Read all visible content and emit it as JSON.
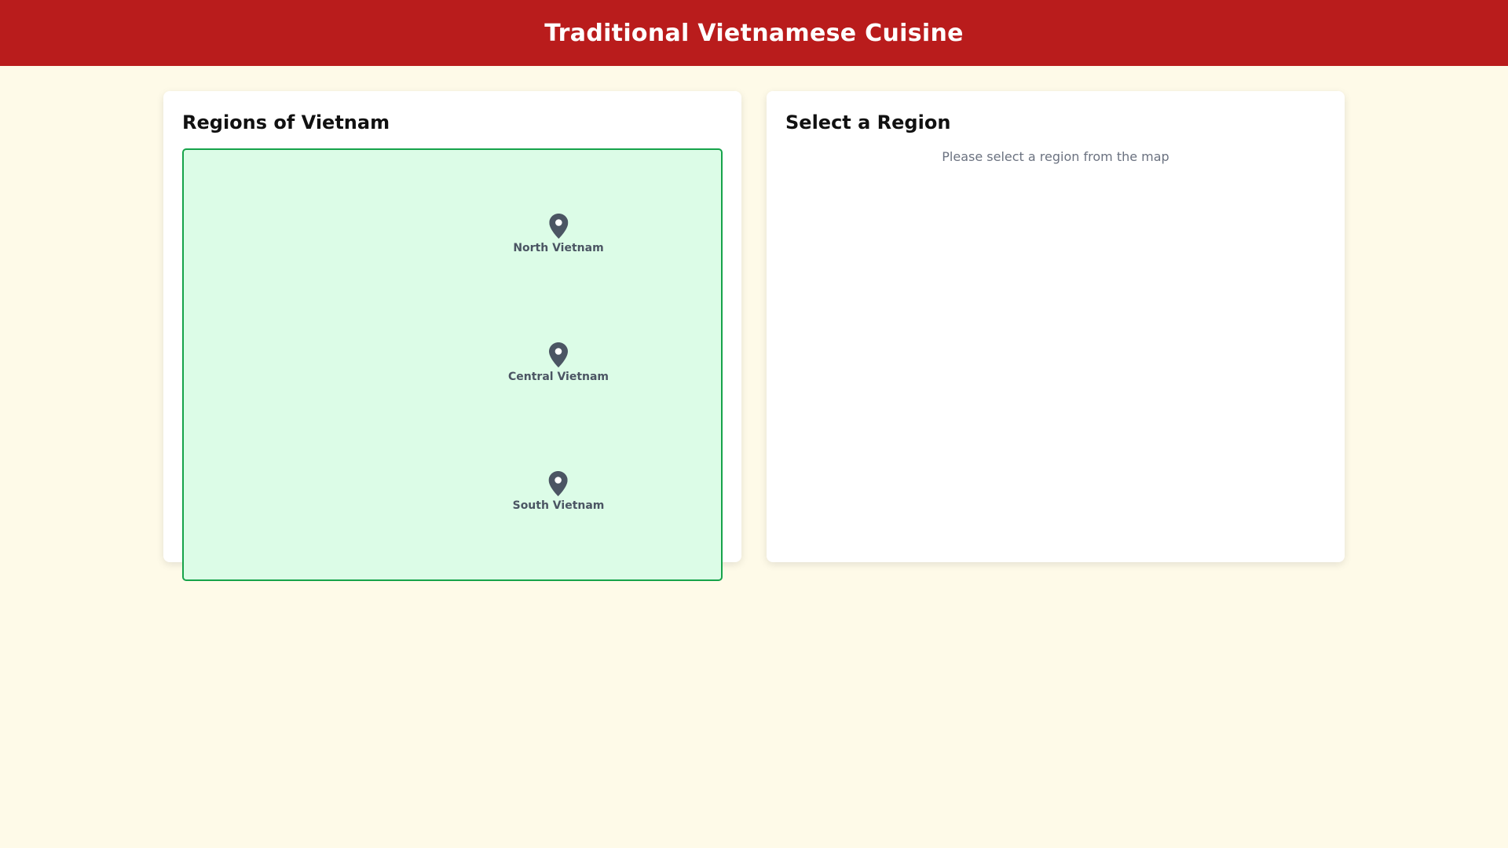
{
  "header": {
    "title": "Traditional Vietnamese Cuisine"
  },
  "map_panel": {
    "title": "Regions of Vietnam",
    "regions": [
      {
        "label": "North Vietnam",
        "icon": "map-pin-icon"
      },
      {
        "label": "Central Vietnam",
        "icon": "map-pin-icon"
      },
      {
        "label": "South Vietnam",
        "icon": "map-pin-icon"
      }
    ]
  },
  "detail_panel": {
    "title": "Select a Region",
    "placeholder": "Please select a region from the map"
  },
  "colors": {
    "header_bg": "#b91c1c",
    "page_bg": "#fefae8",
    "map_bg": "#dcfce7",
    "map_border": "#16a34a",
    "pin": "#4b5563"
  }
}
